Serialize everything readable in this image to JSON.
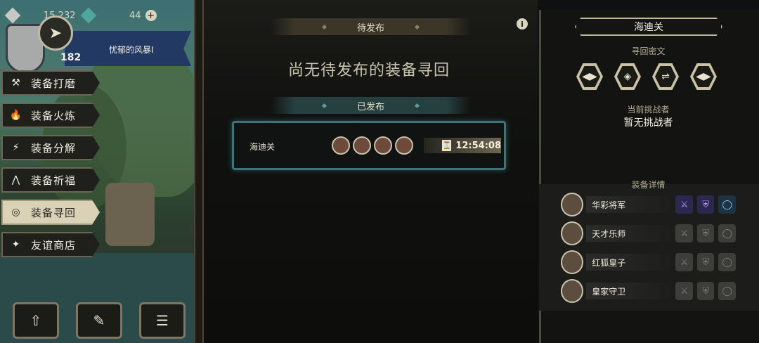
{
  "hud": {
    "coins": "15,232",
    "gems": "44",
    "level": "182",
    "banner_name": "忧郁的风暴I"
  },
  "menu": [
    {
      "label": "装备打磨",
      "icon": "hammer-icon",
      "glyph": "⚒",
      "active": false
    },
    {
      "label": "装备火炼",
      "icon": "flame-icon",
      "glyph": "🔥",
      "active": false
    },
    {
      "label": "装备分解",
      "icon": "break-icon",
      "glyph": "⚡",
      "active": false
    },
    {
      "label": "装备祈福",
      "icon": "pray-hands-icon",
      "glyph": "⋀",
      "active": false
    },
    {
      "label": "装备寻回",
      "icon": "target-icon",
      "glyph": "◎",
      "active": true
    },
    {
      "label": "友谊商店",
      "icon": "fox-icon",
      "glyph": "✦",
      "active": false
    }
  ],
  "bottom_buttons": [
    {
      "icon": "upload-icon",
      "glyph": "⇧"
    },
    {
      "icon": "feather-icon",
      "glyph": "✎"
    },
    {
      "icon": "list-icon",
      "glyph": "☰"
    }
  ],
  "center": {
    "pending_header": "待发布",
    "pending_empty": "尚无待发布的装备寻回",
    "published_header": "已发布",
    "published_card": {
      "name": "海迪关",
      "timer": "12:54:08",
      "avatars": [
        "bird-knight",
        "bunny-hero",
        "fox-hero",
        "helmet-guard"
      ]
    }
  },
  "right": {
    "title": "海迪关",
    "secret_label": "寻回密文",
    "secret_icons": [
      "◀▶",
      "◈",
      "⇌",
      "◀▶"
    ],
    "challenger_label": "当前挑战者",
    "challenger_value": "暂无挑战者",
    "equipment_label": "装备详情",
    "heroes": [
      {
        "name": "华彩将军",
        "portrait": "bird-general",
        "slots": [
          true,
          true,
          true
        ]
      },
      {
        "name": "天才乐师",
        "portrait": "bunny-musician",
        "slots": [
          false,
          false,
          false
        ]
      },
      {
        "name": "红狐皇子",
        "portrait": "fox-prince",
        "slots": [
          false,
          false,
          false
        ]
      },
      {
        "name": "皇家守卫",
        "portrait": "helmet-guard",
        "slots": [
          false,
          false,
          false
        ]
      }
    ]
  }
}
